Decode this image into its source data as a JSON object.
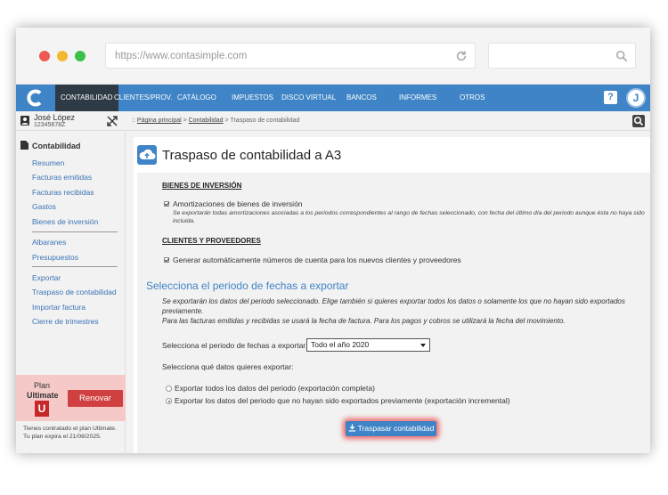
{
  "browser": {
    "url": "https://www.contasimple.com"
  },
  "nav": {
    "items": [
      "CONTABILIDAD",
      "CLIENTES/PROV.",
      "CATÁLOGO",
      "IMPUESTOS",
      "DISCO VIRTUAL",
      "BANCOS",
      "INFORMES",
      "OTROS"
    ],
    "help": "?",
    "avatar": "J"
  },
  "user": {
    "name": "José López",
    "id": "12345678Z"
  },
  "breadcrumb": {
    "prefix": "::",
    "home": "Página principal",
    "sep": ">",
    "section": "Contabilidad",
    "current": "Traspaso de contabilidad"
  },
  "sidebar": {
    "header": "Contabilidad",
    "group1": [
      "Resumen",
      "Facturas emitidas",
      "Facturas recibidas",
      "Gastos",
      "Bienes de inversión"
    ],
    "group2": [
      "Albaranes",
      "Presupuestos"
    ],
    "group3": [
      "Exportar",
      "Traspaso de contabilidad",
      "Importar factura",
      "Cierre de trimestres"
    ]
  },
  "plan": {
    "word": "Plan",
    "name": "Ultimate",
    "badge": "U",
    "renew": "Renovar",
    "note_line1": "Tienes contratado el plan Ultimate.",
    "note_line2": "Tu plan expira el 21/08/2025."
  },
  "page": {
    "title": "Traspaso de contabilidad a A3"
  },
  "assets": {
    "title": "BIENES DE INVERSIÓN",
    "check_label": "Amortizaciones de bienes de inversión",
    "note": "Se exportarán todas amortizaciones asociadas a los periodos correspondientes al rango de fechas seleccionado, con fecha del último día del periodo aunque ésta no haya sido incluida."
  },
  "clients": {
    "title": "CLIENTES Y PROVEEDORES",
    "check_label": "Generar automáticamente números de cuenta para los nuevos clientes y proveedores"
  },
  "period": {
    "title": "Selecciona el periodo de fechas a exportar",
    "note_line1": "Se exportarán los datos del periodo seleccionado. Elige también si quieres exportar todos los datos o solamente los que no hayan sido exportados previamente.",
    "note_line2": "Para las facturas emitidas y recibidas se usará la fecha de factura. Para los pagos y cobros se utilizará la fecha del movimiento.",
    "select_label": "Selecciona el periodo de fechas a exportar:",
    "select_value": "Todo el año 2020",
    "data_label": "Selecciona qué datos quieres exportar:",
    "option_full": "Exportar todos los datos del periodo (exportación completa)",
    "option_incremental": "Exportar los datos del periodo que no hayan sido exportados previamente (exportación incremental)",
    "button": "Traspasar contabilidad"
  },
  "colors": {
    "brand": "#3f84c6",
    "nav_active": "#2e3a46",
    "renew": "#d14040",
    "plan_bg": "#f6c9c9"
  }
}
